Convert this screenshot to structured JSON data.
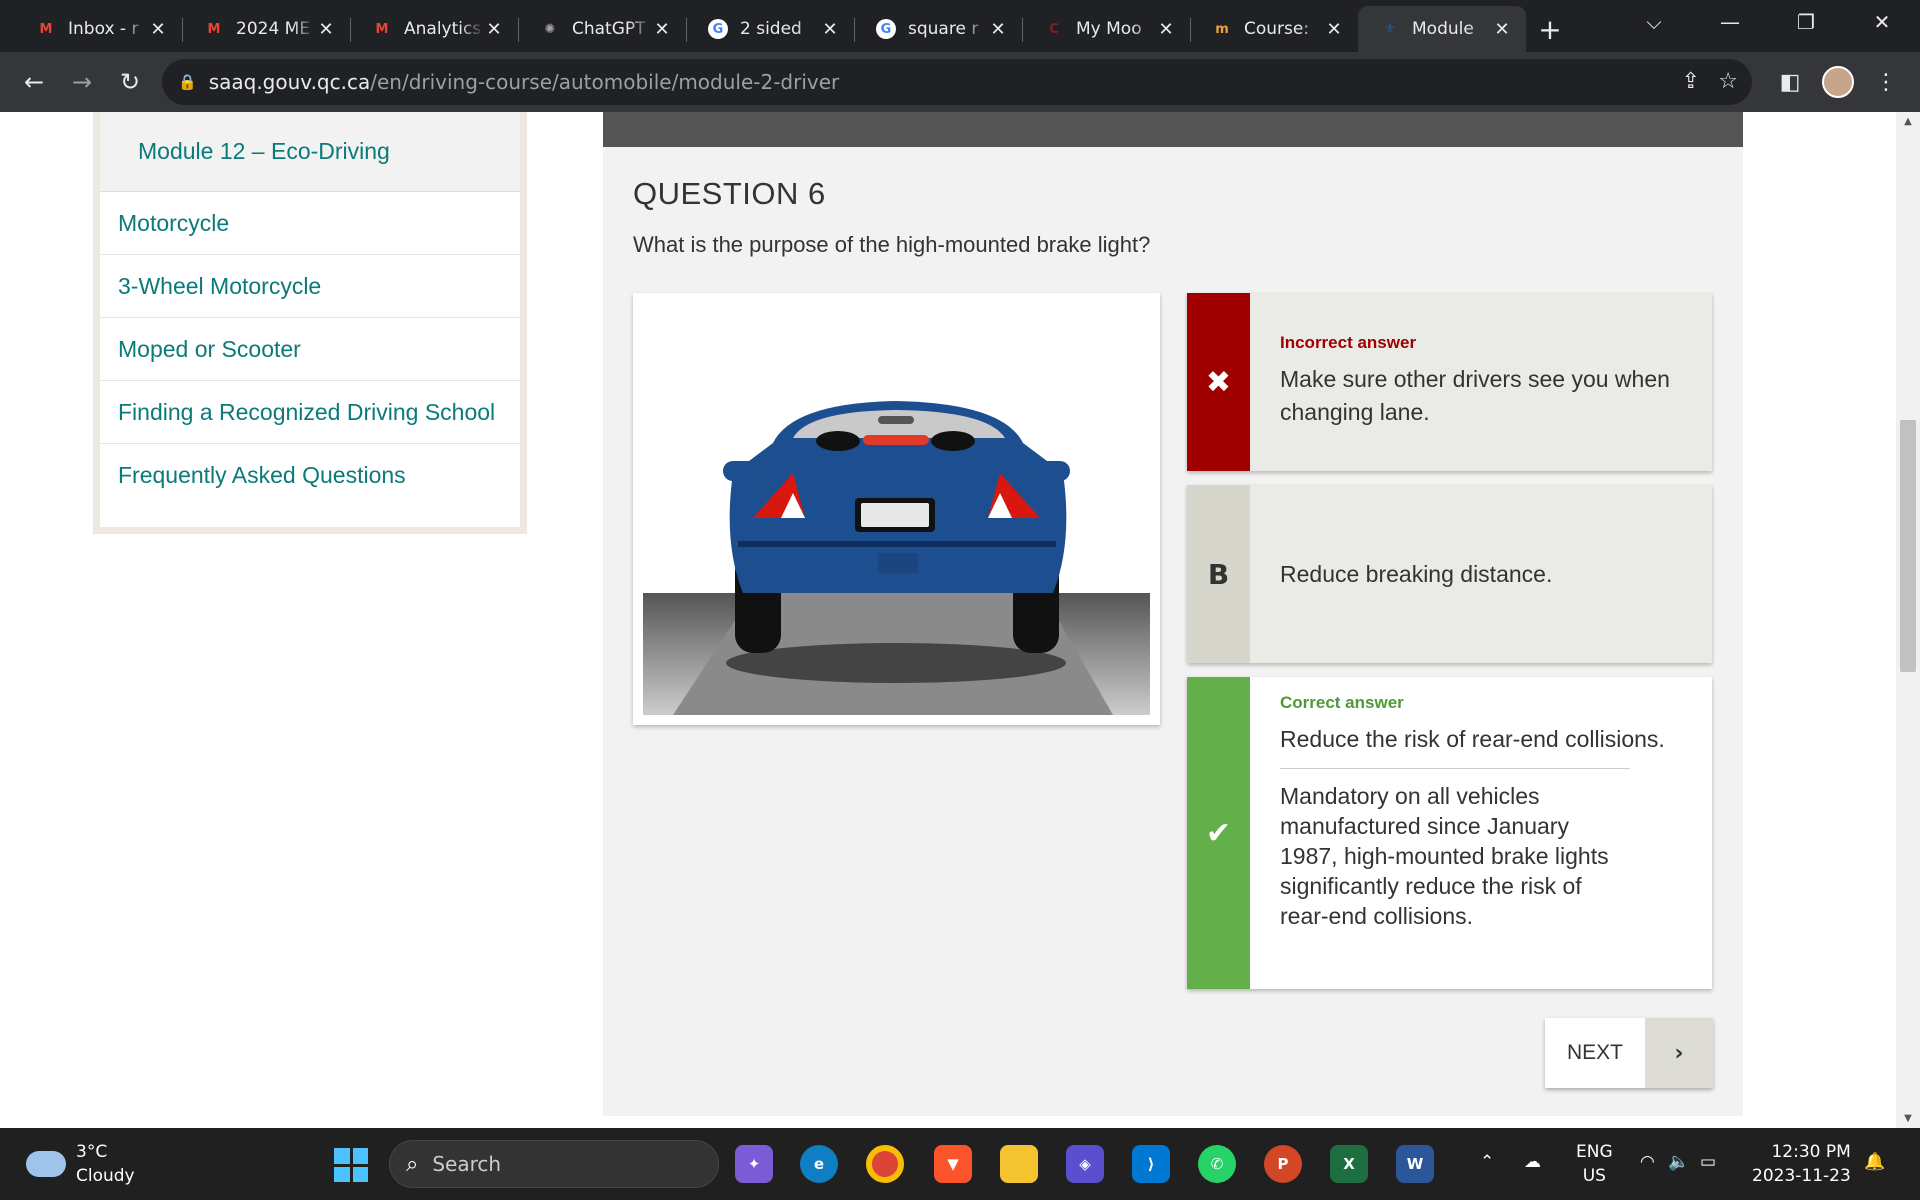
{
  "browser": {
    "tabs": [
      {
        "title": "Inbox - r",
        "icon": "gmail-icon",
        "color": "#ea4335",
        "glyph": "M"
      },
      {
        "title": "2024 ME",
        "icon": "gmail-icon",
        "color": "#ea4335",
        "glyph": "M"
      },
      {
        "title": "Analytics",
        "icon": "gmail-icon",
        "color": "#ea4335",
        "glyph": "M"
      },
      {
        "title": "ChatGPT",
        "icon": "chatgpt-icon",
        "color": "#a3a3a3",
        "glyph": "✺"
      },
      {
        "title": "2 sided",
        "icon": "google-icon",
        "color": "#ffffff",
        "glyph": "G"
      },
      {
        "title": "square r",
        "icon": "google-icon",
        "color": "#ffffff",
        "glyph": "G"
      },
      {
        "title": "My Moo",
        "icon": "moodle-icon",
        "color": "#8b1a2b",
        "glyph": "C"
      },
      {
        "title": "Course:",
        "icon": "course-icon",
        "color": "#e8a33d",
        "glyph": "m"
      },
      {
        "title": "Module",
        "icon": "quebec-fleur-icon",
        "color": "#1a5ea8",
        "glyph": "⚜"
      }
    ],
    "url_domain": "saaq.gouv.qc.ca",
    "url_path": "/en/driving-course/automobile/module-2-driver"
  },
  "sidebar": {
    "sub_item": "Module 12 – Eco-Driving",
    "items": [
      "Motorcycle",
      "3-Wheel Motorcycle",
      "Moped or Scooter",
      "Finding a Recognized Driving School",
      "Frequently Asked Questions"
    ]
  },
  "quiz": {
    "question_label": "QUESTION 6",
    "question_text": "What is the purpose of the high-mounted brake light?",
    "answers": [
      {
        "status": "Incorrect answer",
        "marker": "✖",
        "text": "Make sure other drivers see you when changing lane.",
        "color": "#a00000"
      },
      {
        "status": "",
        "marker": "B",
        "text": "Reduce breaking distance.",
        "color": "#d6d6cc"
      },
      {
        "status": "Correct answer",
        "marker": "✔",
        "text": "Reduce the risk of rear-end collisions.",
        "explanation": "Mandatory on all vehicles manufactured since January 1987, high-mounted brake lights significantly reduce the risk of rear-end collisions.",
        "color": "#63b04a"
      }
    ],
    "next_label": "NEXT",
    "next_arrow": "›"
  },
  "taskbar": {
    "weather_temp": "3°C",
    "weather_desc": "Cloudy",
    "search_placeholder": "Search",
    "lang_1": "ENG",
    "lang_2": "US",
    "time": "12:30 PM",
    "date": "2023-11-23"
  }
}
